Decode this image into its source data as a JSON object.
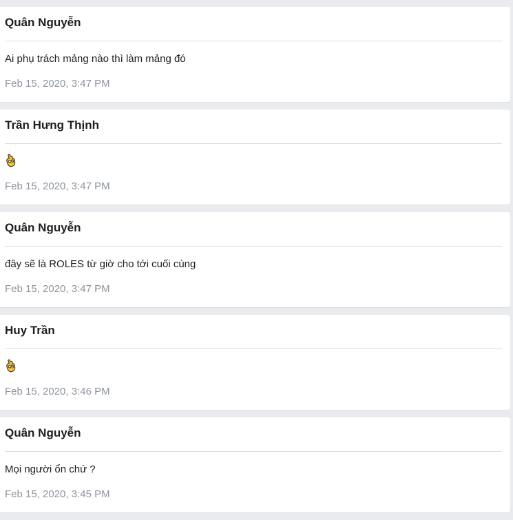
{
  "posts": [
    {
      "author": "Quân Nguyễn",
      "message": "Ai phụ trách mảng nào thì làm mảng đó",
      "time": "Feb 15, 2020, 3:47 PM"
    },
    {
      "author": "Trần Hưng Thịnh",
      "emoji": "ok-hand-icon",
      "time": "Feb 15, 2020, 3:47 PM"
    },
    {
      "author": "Quân Nguyễn",
      "message": "đây sẽ là ROLES từ giờ cho tới cuối cùng",
      "time": "Feb 15, 2020, 3:47 PM"
    },
    {
      "author": "Huy Trần",
      "emoji": "ok-hand-icon",
      "time": "Feb 15, 2020, 3:46 PM"
    },
    {
      "author": "Quân Nguyễn",
      "message": "Mọi người ổn chứ ?",
      "time": "Feb 15, 2020, 3:45 PM"
    }
  ]
}
